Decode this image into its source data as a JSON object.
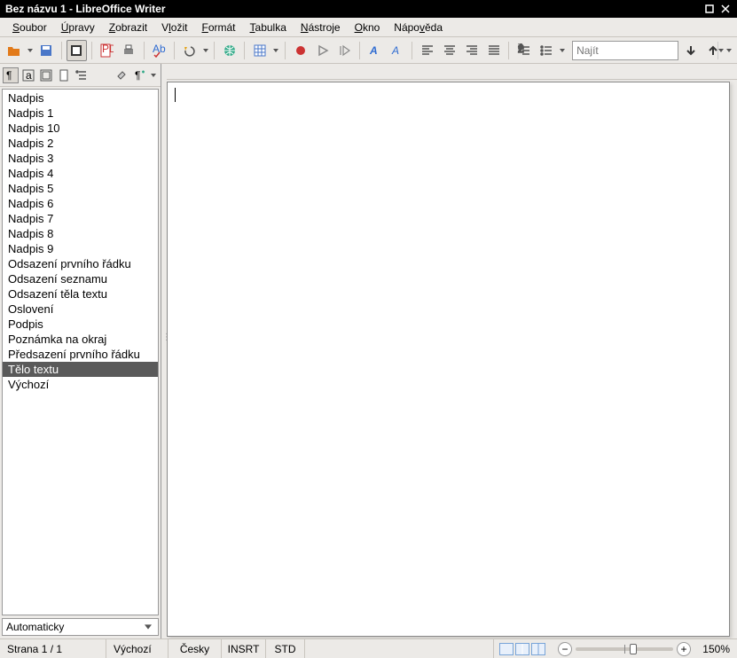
{
  "window": {
    "title": "Bez názvu 1 - LibreOffice Writer"
  },
  "menu": {
    "soubor": {
      "label": "Soubor",
      "u": "S"
    },
    "upravy": {
      "label": "Úpravy",
      "u": "Ú"
    },
    "zobrazit": {
      "label": "Zobrazit",
      "u": "Z"
    },
    "vlozit": {
      "label": "Vložit",
      "u": "l"
    },
    "format": {
      "label": "Formát",
      "u": "F"
    },
    "tabulka": {
      "label": "Tabulka",
      "u": "T"
    },
    "nastroje": {
      "label": "Nástroje",
      "u": "N"
    },
    "okno": {
      "label": "Okno",
      "u": "O"
    },
    "napoveda": {
      "label": "Nápověda",
      "u": "v"
    }
  },
  "find": {
    "placeholder": "Najít"
  },
  "styles_filter": {
    "label": "Automaticky"
  },
  "styles": [
    "Nadpis",
    "Nadpis 1",
    "Nadpis 10",
    "Nadpis 2",
    "Nadpis 3",
    "Nadpis 4",
    "Nadpis 5",
    "Nadpis 6",
    "Nadpis 7",
    "Nadpis 8",
    "Nadpis 9",
    "Odsazení prvního řádku",
    "Odsazení seznamu",
    "Odsazení těla textu",
    "Oslovení",
    "Podpis",
    "Poznámka na okraj",
    "Předsazení prvního řádku",
    "Tělo textu",
    "Výchozí"
  ],
  "styles_selected_index": 18,
  "status": {
    "page": "Strana 1 / 1",
    "style": "Výchozí",
    "lang": "Česky",
    "insert": "INSRT",
    "sel": "STD",
    "zoom": "150%"
  }
}
